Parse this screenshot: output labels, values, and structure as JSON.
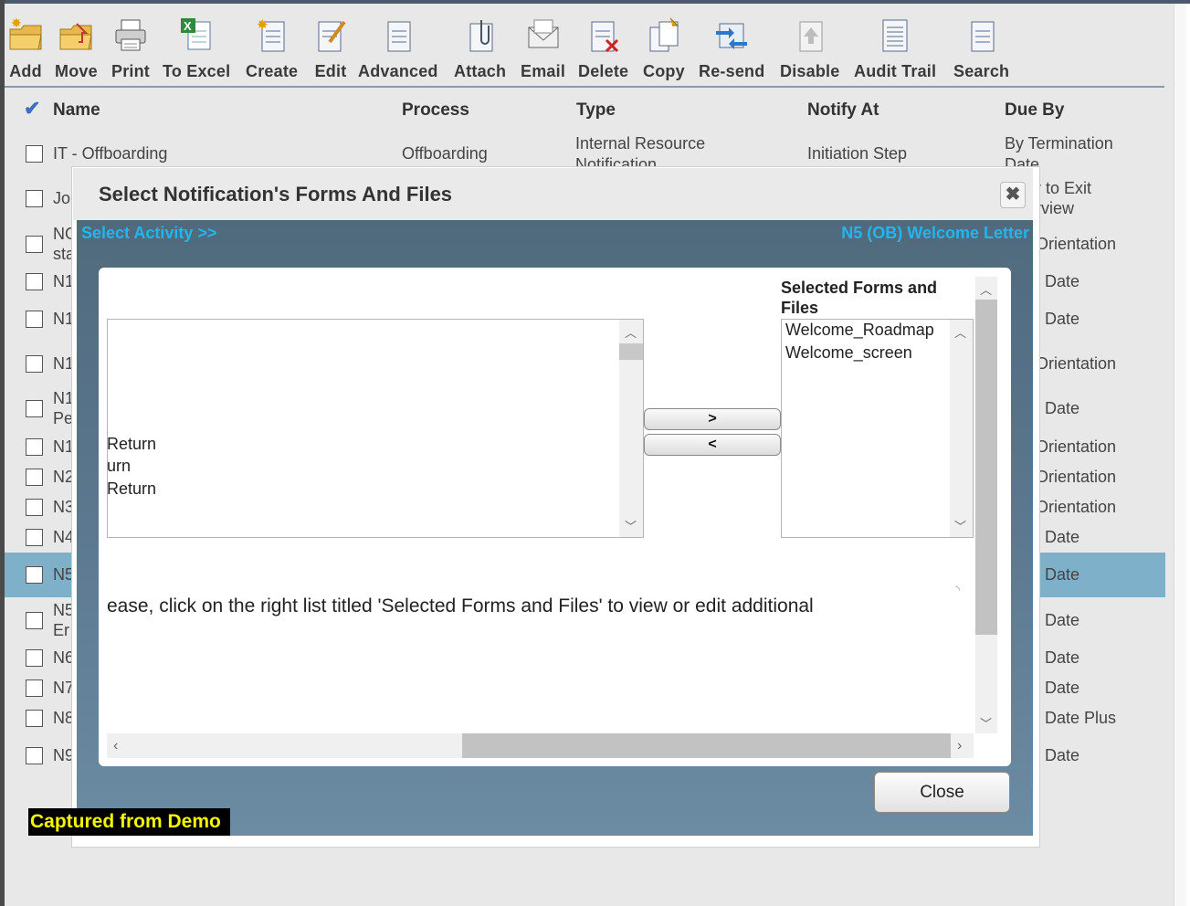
{
  "toolbar": [
    {
      "label": "Add",
      "icon": "folder-add-icon"
    },
    {
      "label": "Move",
      "icon": "folder-move-icon"
    },
    {
      "label": "Print",
      "icon": "printer-icon"
    },
    {
      "label": "To Excel",
      "icon": "excel-icon"
    },
    {
      "label": "Create",
      "icon": "create-doc-icon"
    },
    {
      "label": "Edit",
      "icon": "edit-doc-icon"
    },
    {
      "label": "Advanced",
      "icon": "advanced-doc-icon"
    },
    {
      "label": "Attach",
      "icon": "paperclip-icon"
    },
    {
      "label": "Email",
      "icon": "envelope-icon"
    },
    {
      "label": "Delete",
      "icon": "delete-doc-icon"
    },
    {
      "label": "Copy",
      "icon": "copy-doc-icon"
    },
    {
      "label": "Re-send",
      "icon": "resend-icon"
    },
    {
      "label": "Disable",
      "icon": "disable-icon"
    },
    {
      "label": "Audit Trail",
      "icon": "audit-trail-icon"
    },
    {
      "label": "Search",
      "icon": "search-doc-icon"
    }
  ],
  "table": {
    "headers": {
      "check": "✔",
      "name": "Name",
      "process": "Process",
      "type": "Type",
      "notify_at": "Notify At",
      "due_by": "Due By"
    },
    "first_row": {
      "name": "IT - Offboarding",
      "process": "Offboarding",
      "type_line1": "Internal Resource",
      "type_line2": "Notification",
      "notify_at": "Initiation Step",
      "due_line1": "By Termination",
      "due_line2": "Date"
    },
    "rows": [
      {
        "name": "Jo",
        "name2": "",
        "due": "r to Exit",
        "due2": "rview"
      },
      {
        "name": "NO",
        "name2": "sta",
        "due": "Orientation",
        "due2": ""
      },
      {
        "name": "N1",
        "name2": "",
        "due": ": Date",
        "due2": ""
      },
      {
        "name": "N1",
        "name2": "",
        "due": ": Date",
        "due2": ""
      },
      {
        "name": "N1",
        "name2": "",
        "due": "Orientation",
        "due2": ""
      },
      {
        "name": "N1",
        "name2": "Pe",
        "due": ": Date",
        "due2": ""
      },
      {
        "name": "N1",
        "name2": "",
        "due": "Orientation",
        "due2": ""
      },
      {
        "name": "N2",
        "name2": "",
        "due": "Orientation",
        "due2": ""
      },
      {
        "name": "N3",
        "name2": "",
        "due": "Orientation",
        "due2": ""
      },
      {
        "name": "N4",
        "name2": "",
        "due": ": Date",
        "due2": ""
      },
      {
        "name": "N5",
        "name2": "",
        "due": ": Date",
        "due2": ""
      },
      {
        "name": "N5",
        "name2": "Er",
        "due": ": Date",
        "due2": ""
      },
      {
        "name": "N6",
        "name2": "",
        "due": ": Date",
        "due2": ""
      },
      {
        "name": "N7",
        "name2": "",
        "due": ": Date",
        "due2": ""
      },
      {
        "name": "N8",
        "name2": "",
        "due": ": Date Plus",
        "due2": ""
      },
      {
        "name": "N9",
        "name2": "",
        "due": ": Date",
        "due2": ""
      }
    ]
  },
  "modal": {
    "title": "Select Notification's Forms And Files",
    "close_x": "✖",
    "select_activity": "Select Activity >>",
    "activity_name": "N5 (OB) Welcome Letter",
    "available_items": [
      "Return",
      "urn",
      " Return"
    ],
    "add_button": ">",
    "remove_button": "<",
    "selected_title": "Selected Forms and Files",
    "selected_items": [
      "Welcome_Roadmap",
      "Welcome_screen"
    ],
    "info_text": "ease, click on the right list titled 'Selected Forms and Files' to view or edit additional",
    "close_button": "Close"
  },
  "badge": "Captured from Demo",
  "colors": {
    "highlight_row": "#7fb0c9",
    "link": "#23b5ee",
    "badge_text": "#f5f500"
  }
}
